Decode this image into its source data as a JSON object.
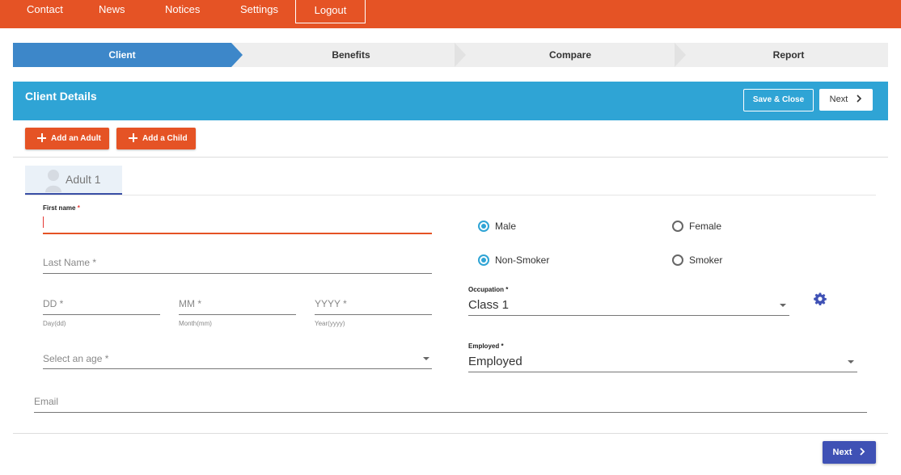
{
  "nav": {
    "items": [
      "Contact",
      "News",
      "Notices",
      "Settings"
    ],
    "logout_label": "Logout"
  },
  "steps": [
    "Client",
    "Benefits",
    "Compare",
    "Report"
  ],
  "active_step": "Client",
  "header": {
    "title": "Client Details",
    "save_close_label": "Save & Close",
    "next_label": "Next"
  },
  "actions": {
    "add_adult_label": "Add an Adult",
    "add_child_label": "Add a Child"
  },
  "tabs": [
    {
      "label": "Adult 1",
      "active": true
    }
  ],
  "form": {
    "first_name": {
      "label": "First name",
      "required_mark": "*",
      "value": ""
    },
    "last_name": {
      "placeholder": "Last Name *",
      "value": ""
    },
    "dob": {
      "day": {
        "placeholder": "DD *",
        "hint": "Day(dd)"
      },
      "month": {
        "placeholder": "MM *",
        "hint": "Month(mm)"
      },
      "year": {
        "placeholder": "YYYY *",
        "hint": "Year(yyyy)"
      }
    },
    "age": {
      "placeholder": "Select an age *"
    },
    "email": {
      "placeholder": "Email"
    },
    "gender": {
      "options": [
        "Male",
        "Female"
      ],
      "selected": "Male"
    },
    "smoker": {
      "options": [
        "Non-Smoker",
        "Smoker"
      ],
      "selected": "Non-Smoker"
    },
    "occupation": {
      "label": "Occupation *",
      "value": "Class 1"
    },
    "employed": {
      "label": "Employed *",
      "value": "Employed"
    }
  },
  "footer": {
    "next_label": "Next"
  },
  "colors": {
    "brand_orange": "#e55325",
    "header_blue": "#2fa4d5",
    "step_active": "#3d87c9",
    "primary_indigo": "#3f51b5",
    "required_red": "#e53935"
  },
  "icons": [
    "plus-icon",
    "chevron-right-icon",
    "user-avatar-icon",
    "gear-icon",
    "caret-down-icon"
  ]
}
